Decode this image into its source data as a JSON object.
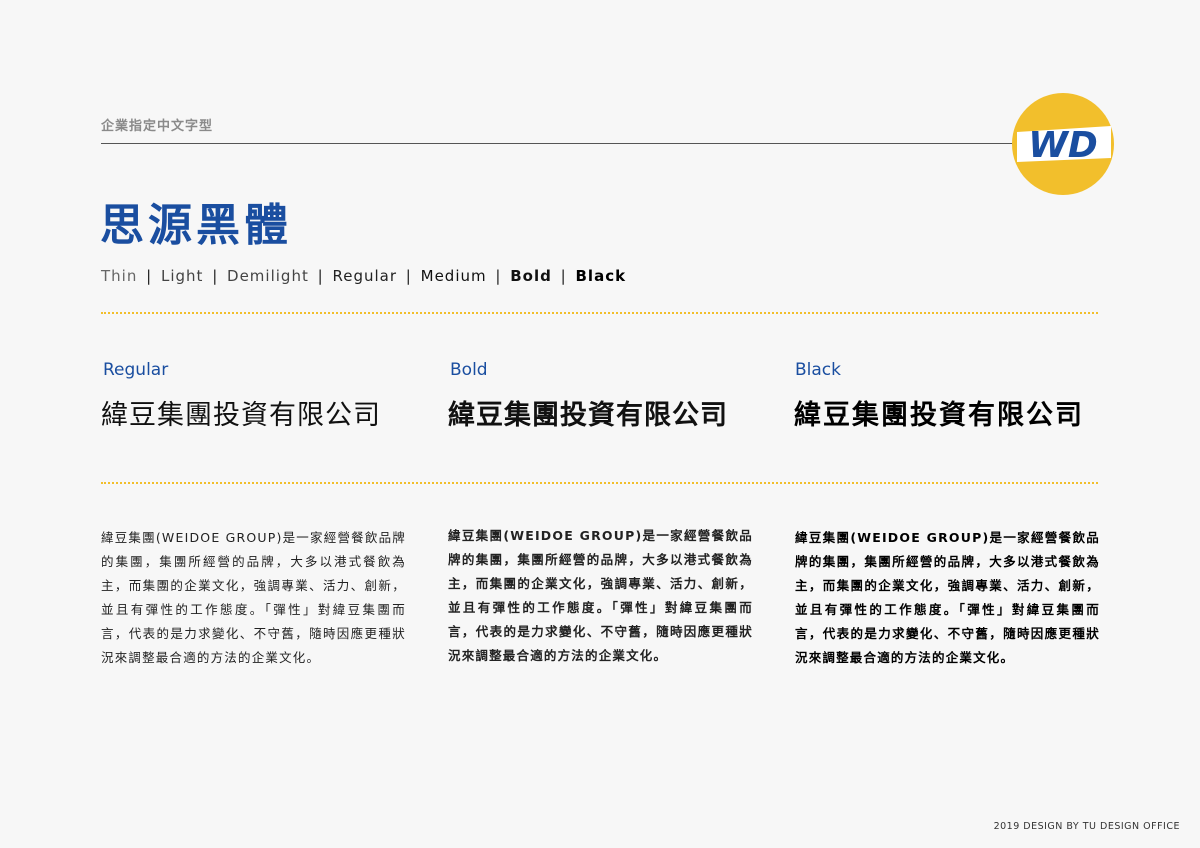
{
  "header": {
    "section_label": "企業指定中文字型",
    "logo_text": "WD",
    "colors": {
      "brand_blue": "#1a4ea0",
      "brand_yellow": "#f2bf2c"
    }
  },
  "title": "思源黑體",
  "weights": {
    "separator": "|",
    "items": [
      "Thin",
      "Light",
      "Demilight",
      "Regular",
      "Medium",
      "Bold",
      "Black"
    ]
  },
  "columns": [
    {
      "label": "Regular",
      "sample": "緯豆集團投資有限公司",
      "body": "緯豆集團(WEIDOE GROUP)是一家經營餐飲品牌的集團，集團所經營的品牌，大多以港式餐飲為主，而集團的企業文化，強調專業、活力、創新，並且有彈性的工作態度。「彈性」對緯豆集團而言，代表的是力求變化、不守舊，隨時因應更種狀況來調整最合適的方法的企業文化。"
    },
    {
      "label": "Bold",
      "sample": "緯豆集團投資有限公司",
      "body": "緯豆集團(WEIDOE GROUP)是一家經營餐飲品牌的集團，集團所經營的品牌，大多以港式餐飲為主，而集團的企業文化，強調專業、活力、創新，並且有彈性的工作態度。「彈性」對緯豆集團而言，代表的是力求變化、不守舊，隨時因應更種狀況來調整最合適的方法的企業文化。"
    },
    {
      "label": "Black",
      "sample": "緯豆集團投資有限公司",
      "body": "緯豆集團(WEIDOE GROUP)是一家經營餐飲品牌的集團，集團所經營的品牌，大多以港式餐飲為主，而集團的企業文化，強調專業、活力、創新，並且有彈性的工作態度。「彈性」對緯豆集團而言，代表的是力求變化、不守舊，隨時因應更種狀況來調整最合適的方法的企業文化。"
    }
  ],
  "footer": "2019 DESIGN BY TU DESIGN OFFICE"
}
